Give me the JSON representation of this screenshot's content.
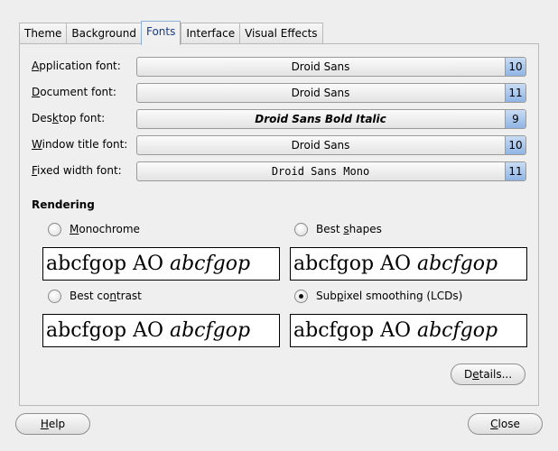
{
  "tabs": [
    "Theme",
    "Background",
    "Fonts",
    "Interface",
    "Visual Effects"
  ],
  "active_tab": "Fonts",
  "fonts": [
    {
      "label_pre": "",
      "label_key": "A",
      "label_post": "pplication font:",
      "font": "Droid Sans",
      "size": "10"
    },
    {
      "label_pre": "",
      "label_key": "D",
      "label_post": "ocument font:",
      "font": "Droid Sans",
      "size": "11"
    },
    {
      "label_pre": "Des",
      "label_key": "k",
      "label_post": "top font:",
      "font": "Droid Sans Bold Italic",
      "size": "9"
    },
    {
      "label_pre": "",
      "label_key": "W",
      "label_post": "indow title font:",
      "font": "Droid Sans",
      "size": "10"
    },
    {
      "label_pre": "",
      "label_key": "F",
      "label_post": "ixed width font:",
      "font": "Droid Sans Mono",
      "size": "11"
    }
  ],
  "rendering": {
    "title": "Rendering",
    "options": [
      {
        "label_pre": "",
        "label_key": "M",
        "label_post": "onochrome",
        "checked": false
      },
      {
        "label_pre": "Best ",
        "label_key": "s",
        "label_post": "hapes",
        "checked": false
      },
      {
        "label_pre": "Best co",
        "label_key": "n",
        "label_post": "trast",
        "checked": false
      },
      {
        "label_pre": "Sub",
        "label_key": "p",
        "label_post": "ixel smoothing (LCDs)",
        "checked": true
      }
    ],
    "preview_plain": "abcfgop AO ",
    "preview_italic": "abcfgop"
  },
  "buttons": {
    "details_pre": "D",
    "details_key": "e",
    "details_post": "tails...",
    "help_pre": "",
    "help_key": "H",
    "help_post": "elp",
    "close_pre": "",
    "close_key": "C",
    "close_post": "lose"
  }
}
